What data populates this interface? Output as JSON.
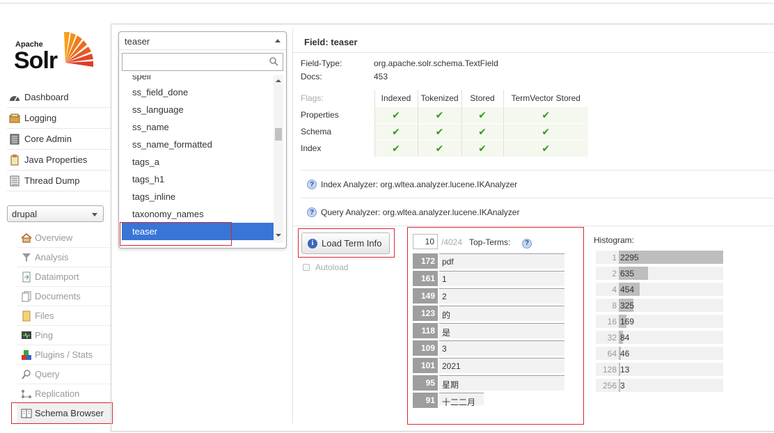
{
  "logo": {
    "apache": "Apache",
    "solr": "Solr"
  },
  "nav": [
    {
      "label": "Dashboard",
      "icon": "dashboard-icon"
    },
    {
      "label": "Logging",
      "icon": "logging-icon"
    },
    {
      "label": "Core Admin",
      "icon": "core-admin-icon"
    },
    {
      "label": "Java Properties",
      "icon": "java-properties-icon"
    },
    {
      "label": "Thread Dump",
      "icon": "thread-dump-icon"
    }
  ],
  "core_selector": {
    "value": "drupal"
  },
  "core_menu": [
    {
      "label": "Overview",
      "icon": "home-icon"
    },
    {
      "label": "Analysis",
      "icon": "funnel-icon"
    },
    {
      "label": "Dataimport",
      "icon": "dataimport-icon"
    },
    {
      "label": "Documents",
      "icon": "documents-icon"
    },
    {
      "label": "Files",
      "icon": "folder-icon"
    },
    {
      "label": "Ping",
      "icon": "ping-icon"
    },
    {
      "label": "Plugins / Stats",
      "icon": "plugins-icon"
    },
    {
      "label": "Query",
      "icon": "magnifier-icon"
    },
    {
      "label": "Replication",
      "icon": "replication-icon"
    },
    {
      "label": "Schema Browser",
      "icon": "book-icon"
    }
  ],
  "field_select": {
    "value": "teaser",
    "search_placeholder": "",
    "options": [
      "spell",
      "ss_field_done",
      "ss_language",
      "ss_name",
      "ss_name_formatted",
      "tags_a",
      "tags_h1",
      "tags_inline",
      "taxonomy_names",
      "teaser"
    ]
  },
  "field": {
    "title": "Field: teaser",
    "type_label": "Field-Type:",
    "type_value": "org.apache.solr.schema.TextField",
    "docs_label": "Docs:",
    "docs_value": "453"
  },
  "flags": {
    "header": [
      "Flags:",
      "Indexed",
      "Tokenized",
      "Stored",
      "TermVector Stored"
    ],
    "rows": [
      {
        "label": "Properties",
        "checks": [
          true,
          true,
          true,
          true
        ]
      },
      {
        "label": "Schema",
        "checks": [
          true,
          true,
          true,
          true
        ]
      },
      {
        "label": "Index",
        "checks": [
          true,
          true,
          true,
          true
        ]
      }
    ]
  },
  "analyzers": {
    "index": "Index Analyzer: org.wltea.analyzer.lucene.IKAnalyzer",
    "query": "Query Analyzer: org.wltea.analyzer.lucene.IKAnalyzer"
  },
  "load": {
    "button": "Load Term Info",
    "autoload": "Autoload"
  },
  "top_terms": {
    "count": "10",
    "total": "/4024",
    "label": "Top-Terms:",
    "terms": [
      {
        "count": "172",
        "term": "pdf"
      },
      {
        "count": "161",
        "term": "1"
      },
      {
        "count": "149",
        "term": "2"
      },
      {
        "count": "123",
        "term": "的"
      },
      {
        "count": "118",
        "term": "是"
      },
      {
        "count": "109",
        "term": "3"
      },
      {
        "count": "101",
        "term": "2021"
      },
      {
        "count": "95",
        "term": "星期"
      },
      {
        "count": "91",
        "term": "十二二月"
      }
    ]
  },
  "histogram": {
    "title": "Histogram:",
    "rows": [
      {
        "key": "1",
        "value": "2295",
        "fraction": 1.0
      },
      {
        "key": "2",
        "value": "635",
        "fraction": 0.28
      },
      {
        "key": "4",
        "value": "454",
        "fraction": 0.2
      },
      {
        "key": "8",
        "value": "325",
        "fraction": 0.14
      },
      {
        "key": "16",
        "value": "169",
        "fraction": 0.075
      },
      {
        "key": "32",
        "value": "84",
        "fraction": 0.04
      },
      {
        "key": "64",
        "value": "46",
        "fraction": 0.02
      },
      {
        "key": "128",
        "value": "13",
        "fraction": 0.006
      },
      {
        "key": "256",
        "value": "3",
        "fraction": 0.002
      }
    ]
  },
  "colors": {
    "highlight": "#d9262d",
    "selected": "#3875d7",
    "check": "#2f9e1a"
  }
}
